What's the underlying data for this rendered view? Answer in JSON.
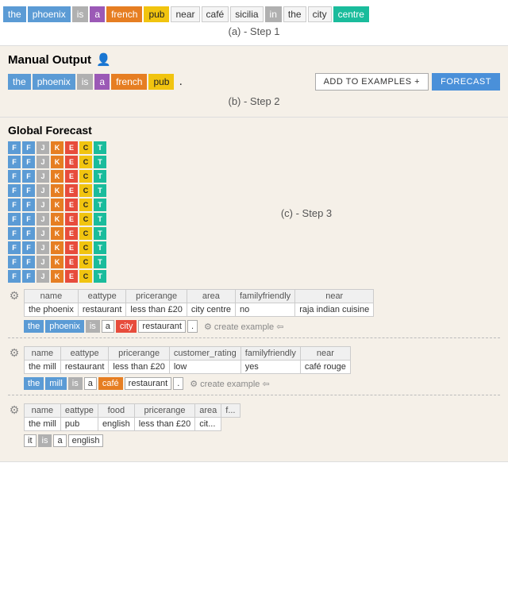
{
  "sectionA": {
    "tokens": [
      {
        "text": "the",
        "color": "blue"
      },
      {
        "text": "phoenix",
        "color": "blue"
      },
      {
        "text": "is",
        "color": "gray"
      },
      {
        "text": "a",
        "color": "purple"
      },
      {
        "text": "french",
        "color": "orange"
      },
      {
        "text": "pub",
        "color": "yellow"
      },
      {
        "text": "near",
        "color": "plain"
      },
      {
        "text": "café",
        "color": "plain"
      },
      {
        "text": "sicilia",
        "color": "plain"
      },
      {
        "text": "in",
        "color": "gray"
      },
      {
        "text": "the",
        "color": "plain"
      },
      {
        "text": "city",
        "color": "plain"
      },
      {
        "text": "centre",
        "color": "teal"
      }
    ],
    "stepLabel": "(a) - Step 1"
  },
  "sectionB": {
    "title": "Manual Output",
    "iconLabel": "👤",
    "tokens": [
      {
        "text": "the",
        "color": "blue"
      },
      {
        "text": "phoenix",
        "color": "blue"
      },
      {
        "text": "is",
        "color": "gray"
      },
      {
        "text": "a",
        "color": "purple"
      },
      {
        "text": "french",
        "color": "orange"
      },
      {
        "text": "pub",
        "color": "yellow"
      }
    ],
    "dot": ".",
    "addButton": "ADD TO EXAMPLES +",
    "forecastButton": "FORECAST",
    "stepLabel": "(b) - Step 2"
  },
  "sectionC": {
    "title": "Global Forecast",
    "forecastRows": 10,
    "forecastCols": [
      {
        "letter": "F",
        "colors": [
          "fc-blue",
          "fc-blue",
          "fc-blue",
          "fc-blue",
          "fc-blue",
          "fc-blue",
          "fc-blue",
          "fc-blue",
          "fc-blue",
          "fc-blue"
        ]
      },
      {
        "letter": "F",
        "colors": [
          "fc-blue",
          "fc-blue",
          "fc-blue",
          "fc-blue",
          "fc-blue",
          "fc-blue",
          "fc-blue",
          "fc-blue",
          "fc-blue",
          "fc-blue"
        ]
      },
      {
        "letter": "J",
        "colors": [
          "fc-gray",
          "fc-gray",
          "fc-gray",
          "fc-gray",
          "fc-gray",
          "fc-gray",
          "fc-gray",
          "fc-gray",
          "fc-gray",
          "fc-gray"
        ]
      },
      {
        "letter": "K",
        "colors": [
          "fc-orange",
          "fc-orange",
          "fc-orange",
          "fc-orange",
          "fc-orange",
          "fc-orange",
          "fc-orange",
          "fc-orange",
          "fc-orange",
          "fc-orange"
        ]
      },
      {
        "letter": "E",
        "colors": [
          "fc-red",
          "fc-red",
          "fc-red",
          "fc-red",
          "fc-red",
          "fc-red",
          "fc-red",
          "fc-red",
          "fc-red",
          "fc-red"
        ]
      },
      {
        "letter": "C",
        "colors": [
          "fc-yellow",
          "fc-yellow",
          "fc-yellow",
          "fc-yellow",
          "fc-yellow",
          "fc-yellow",
          "fc-yellow",
          "fc-yellow",
          "fc-yellow",
          "fc-yellow"
        ]
      },
      {
        "letter": "T",
        "colors": [
          "fc-teal",
          "fc-teal",
          "fc-teal",
          "fc-teal",
          "fc-teal",
          "fc-teal",
          "fc-teal",
          "fc-teal",
          "fc-teal",
          "fc-teal"
        ]
      }
    ],
    "stepLabel": "(c) - Step 3",
    "dataBlocks": [
      {
        "columns": [
          "name",
          "eattype",
          "pricerange",
          "area",
          "familyfriendly",
          "near"
        ],
        "rows": [
          [
            "the phoenix",
            "restaurant",
            "less than £20",
            "city centre",
            "no",
            "raja indian cuisine"
          ]
        ],
        "exampleTokens": [
          {
            "text": "the",
            "color": "blue"
          },
          {
            "text": "phoenix",
            "color": "blue"
          },
          {
            "text": "is",
            "color": "gray"
          },
          {
            "text": "a",
            "color": "plain"
          },
          {
            "text": "city",
            "color": "red"
          },
          {
            "text": "restaurant",
            "color": "plain"
          },
          {
            "text": ".",
            "color": "plain"
          }
        ],
        "createLabel": "create example ⇦"
      },
      {
        "columns": [
          "name",
          "eattype",
          "pricerange",
          "customer_rating",
          "familyfriendly",
          "near"
        ],
        "rows": [
          [
            "the mill",
            "restaurant",
            "less than £20",
            "low",
            "yes",
            "café rouge"
          ]
        ],
        "exampleTokens": [
          {
            "text": "the",
            "color": "blue"
          },
          {
            "text": "mill",
            "color": "blue"
          },
          {
            "text": "is",
            "color": "gray"
          },
          {
            "text": "a",
            "color": "plain"
          },
          {
            "text": "café",
            "color": "orange"
          },
          {
            "text": "restaurant",
            "color": "plain"
          },
          {
            "text": ".",
            "color": "plain"
          }
        ],
        "createLabel": "create example ⇦"
      },
      {
        "columns": [
          "name",
          "eattype",
          "food",
          "pricerange",
          "area",
          "f..."
        ],
        "rows": [
          [
            "the mill",
            "pub",
            "english",
            "less than £20",
            "cit..."
          ]
        ],
        "exampleTokens": [
          {
            "text": "it",
            "color": "plain"
          },
          {
            "text": "is",
            "color": "gray"
          },
          {
            "text": "a",
            "color": "plain"
          },
          {
            "text": "english",
            "color": "plain"
          }
        ],
        "createLabel": ""
      }
    ]
  }
}
